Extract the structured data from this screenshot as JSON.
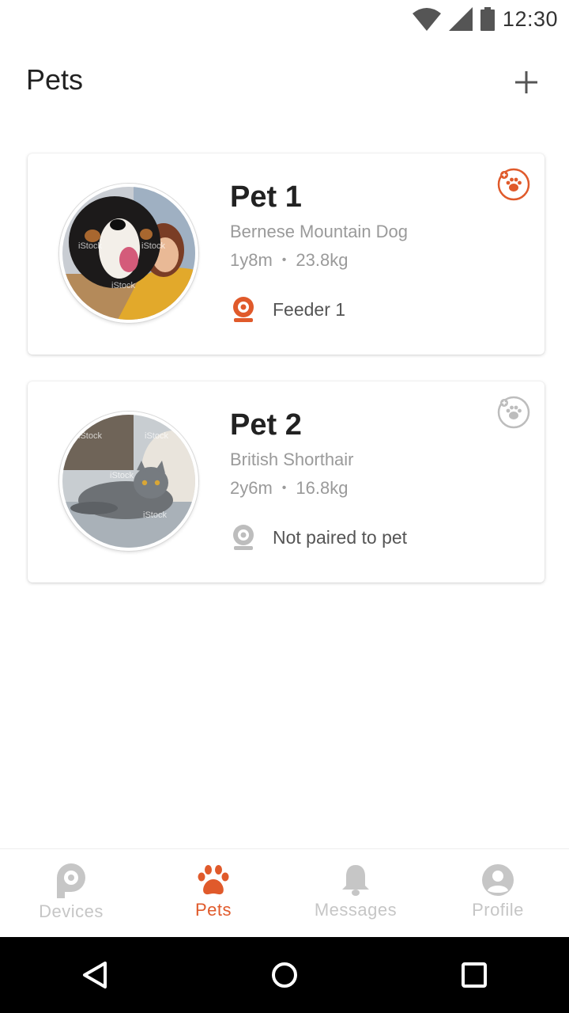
{
  "status_bar": {
    "time": "12:30",
    "icons": [
      "wifi-icon",
      "signal-icon",
      "battery-icon"
    ]
  },
  "header": {
    "title": "Pets",
    "add_icon": "plus-icon"
  },
  "pets": [
    {
      "name": "Pet 1",
      "breed": "Bernese Mountain Dog",
      "age": "1y8m",
      "weight": "23.8kg",
      "feeder": "Feeder 1",
      "paired": true
    },
    {
      "name": "Pet 2",
      "breed": "British Shorthair",
      "age": "2y6m",
      "weight": "16.8kg",
      "feeder": "Not paired to pet",
      "paired": false
    }
  ],
  "stat_separator": "•",
  "photo_watermark": "iStock",
  "bottom_nav": {
    "items": [
      {
        "label": "Devices",
        "icon": "devices-icon",
        "active": false
      },
      {
        "label": "Pets",
        "icon": "paw-icon",
        "active": true
      },
      {
        "label": "Messages",
        "icon": "bell-icon",
        "active": false
      },
      {
        "label": "Profile",
        "icon": "profile-icon",
        "active": false
      }
    ]
  },
  "colors": {
    "accent": "#e05a2b",
    "inactive": "#c6c6c6",
    "text_secondary": "#9a9a9a"
  }
}
